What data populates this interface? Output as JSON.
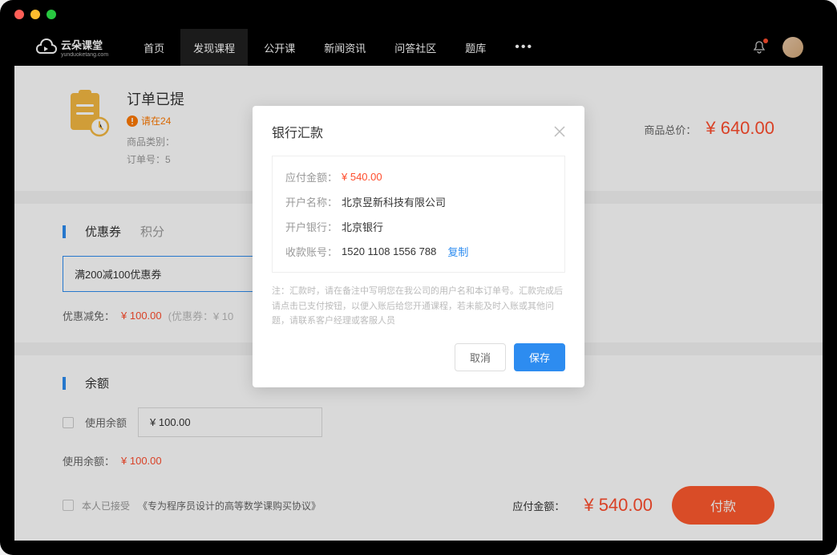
{
  "logo": {
    "name": "云朵课堂",
    "sub": "yunduoketang.com"
  },
  "nav": {
    "items": [
      "首页",
      "发现课程",
      "公开课",
      "新闻资讯",
      "问答社区",
      "题库"
    ],
    "active_index": 1
  },
  "order": {
    "title": "订单已提",
    "warning": "请在24",
    "meta_category_label": "商品类别：",
    "meta_id_label": "订单号：5",
    "total_label": "商品总价：",
    "total_value": "¥ 640.00"
  },
  "coupon": {
    "tab1": "优惠券",
    "tab2": "积分",
    "selected": "满200减100优惠券",
    "discount_label": "优惠减免：",
    "discount_value": "¥ 100.00",
    "discount_note": "(优惠券：¥ 10"
  },
  "balance": {
    "title": "余额",
    "use_label": "使用余额",
    "input_value": "¥ 100.00",
    "used_label": "使用余额：",
    "used_value": "¥ 100.00"
  },
  "footer": {
    "agree_prefix": "本人已接受",
    "agree_link": "《专为程序员设计的高等数学课购买协议》",
    "amount_label": "应付金额：",
    "amount_value": "¥ 540.00",
    "pay_btn": "付款"
  },
  "modal": {
    "title": "银行汇款",
    "amount_label": "应付金额：",
    "amount_value": "¥ 540.00",
    "account_name_label": "开户名称：",
    "account_name_value": "北京昱新科技有限公司",
    "bank_label": "开户银行：",
    "bank_value": "北京银行",
    "account_no_label": "收款账号：",
    "account_no_value": "1520 1108 1556 788",
    "copy": "复制",
    "note_label": "注：",
    "note": "汇款时，请在备注中写明您在我公司的用户名和本订单号。汇款完成后请点击已支付按钮，以便入账后给您开通课程，若未能及时入账或其他问题，请联系客户经理或客服人员",
    "cancel": "取消",
    "save": "保存"
  }
}
